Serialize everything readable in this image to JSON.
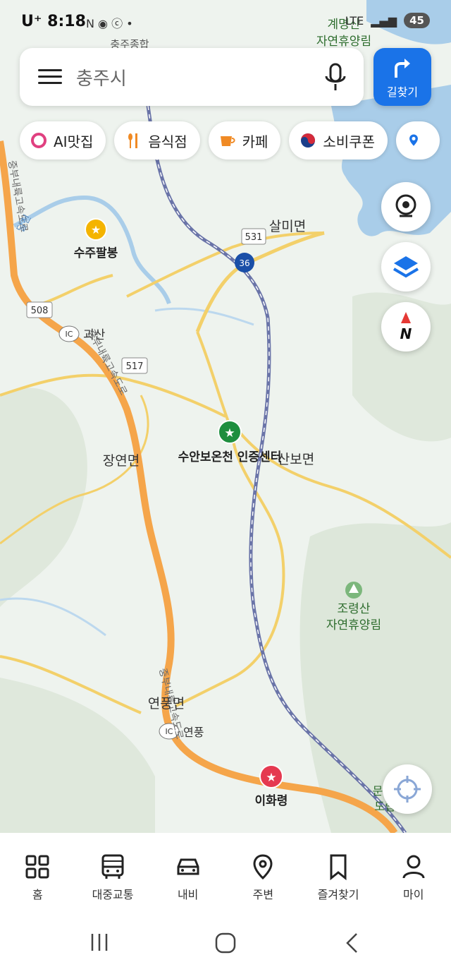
{
  "status": {
    "carrier": "U⁺",
    "time": "8:18",
    "battery": "45",
    "network": "LTE"
  },
  "search": {
    "query": "충주시",
    "directions_label": "길찾기"
  },
  "chips": [
    {
      "label": "AI맛집",
      "icon": "ai-ring-icon"
    },
    {
      "label": "음식점",
      "icon": "fork-knife-icon"
    },
    {
      "label": "카페",
      "icon": "coffee-cup-icon"
    },
    {
      "label": "소비쿠폰",
      "icon": "korea-flag-icon"
    }
  ],
  "map": {
    "labels": {
      "salmimyeon": "살미면",
      "suju": "수주팔봉",
      "goesan": "괴산",
      "jangyeonmyeon": "장연면",
      "suanbo": "수안보온천 인증센터",
      "sanbomyeon": "산보면",
      "joryeong1": "조령산",
      "joryeong2": "자연휴양림",
      "yeonpungmyeon": "연풍면",
      "yeonpung_ic": "연풍",
      "ihwaryeong": "이화령",
      "top1": "계명산",
      "top2": "자연휴양림",
      "top_city": "충주종합",
      "mun1": "문",
      "mun2": "도립",
      "expressway_a": "중부내륙고속도로",
      "expressway_b": "중부내륙고속도로",
      "expressway_c": "중부내륙고속도로",
      "stream": "달천"
    },
    "ic_badge": "IC",
    "route_numbers": {
      "r531": "531",
      "r36": "36",
      "r508": "508",
      "r517": "517"
    }
  },
  "nav": [
    {
      "label": "홈",
      "icon": "home-grid-icon"
    },
    {
      "label": "대중교통",
      "icon": "bus-icon"
    },
    {
      "label": "내비",
      "icon": "car-icon"
    },
    {
      "label": "주변",
      "icon": "location-pin-icon"
    },
    {
      "label": "즐겨찾기",
      "icon": "bookmark-icon"
    },
    {
      "label": "마이",
      "icon": "person-icon"
    }
  ],
  "colors": {
    "accent": "#1a73e8",
    "expressway": "#f5a54a",
    "road": "#f3d06a",
    "railway": "#6a74a8",
    "water": "#a9cde9",
    "land": "#eef3ee",
    "forest": "#dfe8dc"
  }
}
